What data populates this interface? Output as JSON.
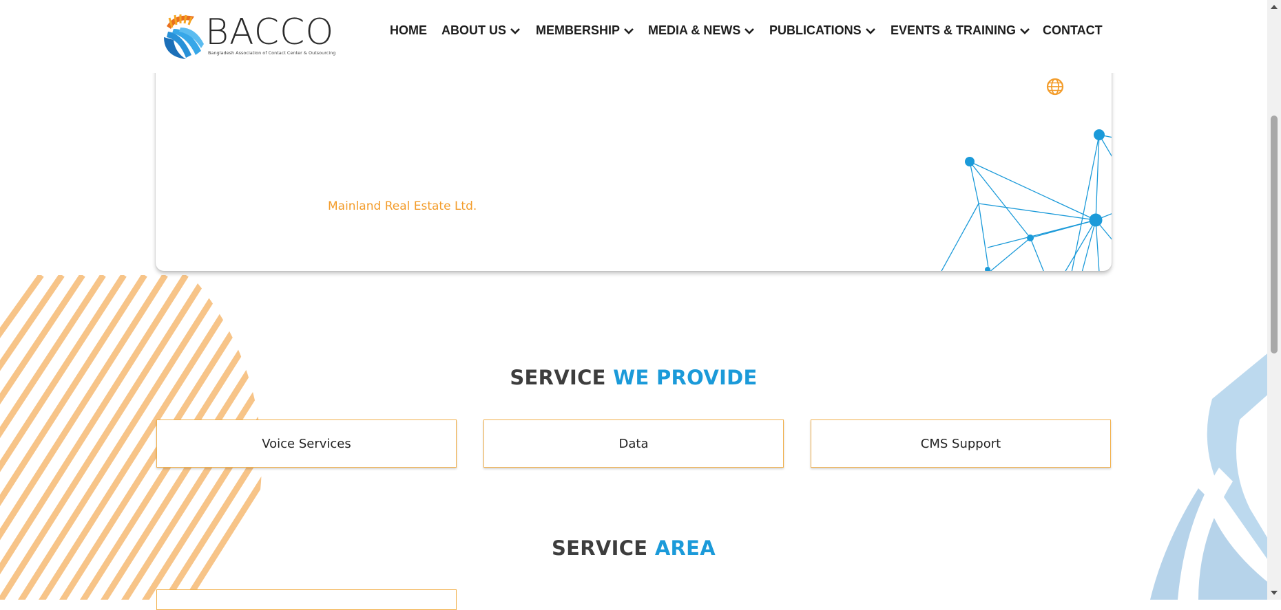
{
  "brand": {
    "name": "BACCO",
    "tagline": "Bangladesh Association of Contact Center & Outsourcing"
  },
  "nav": {
    "items": [
      {
        "label": "HOME",
        "dropdown": false
      },
      {
        "label": "ABOUT US",
        "dropdown": true
      },
      {
        "label": "MEMBERSHIP",
        "dropdown": true
      },
      {
        "label": "MEDIA & NEWS",
        "dropdown": true
      },
      {
        "label": "PUBLICATIONS",
        "dropdown": true
      },
      {
        "label": "EVENTS & TRAINING",
        "dropdown": true
      },
      {
        "label": "CONTACT",
        "dropdown": false
      }
    ]
  },
  "profile": {
    "company_name": "Mainland Real Estate Ltd.",
    "icons": [
      "globe-icon"
    ]
  },
  "services_provided": {
    "title_part1": "SERVICE",
    "title_part2": "WE PROVIDE",
    "items": [
      "Voice Services",
      "Data",
      "CMS Support"
    ]
  },
  "service_area": {
    "title_part1": "SERVICE",
    "title_part2": "AREA"
  },
  "colors": {
    "accent_orange": "#f39c2a",
    "accent_blue": "#1b9ad9",
    "text_dark": "#3d3d3d"
  }
}
